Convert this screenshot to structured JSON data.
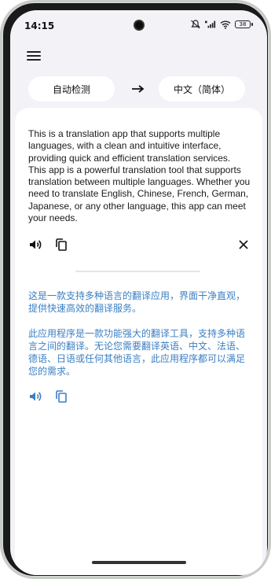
{
  "status_bar": {
    "time": "14:15",
    "battery": "38",
    "icons": [
      "mute-icon",
      "hd-signal-icon",
      "wifi-icon",
      "battery-icon"
    ]
  },
  "header": {
    "menu_icon": "menu-icon",
    "source_language": "自动检测",
    "target_language": "中文（简体）",
    "swap_icon": "arrow-right-icon"
  },
  "source": {
    "text": "This is a translation app that supports multiple languages, with a clean and intuitive interface, providing quick and efficient translation services. This app is a powerful translation tool that supports translation between multiple languages. Whether you need to translate English, Chinese, French, German, Japanese, or any other language, this app can meet your needs.",
    "actions": [
      "speaker-icon",
      "copy-icon",
      "close-icon"
    ]
  },
  "result": {
    "paragraphs": [
      "这是一款支持多种语言的翻译应用，界面干净直观，提供快速高效的翻译服务。",
      "此应用程序是一款功能强大的翻译工具，支持多种语言之间的翻译。无论您需要翻译英语、中文、法语、德语、日语或任何其他语言，此应用程序都可以满足您的需求。"
    ],
    "actions": [
      "speaker-icon",
      "copy-icon"
    ]
  },
  "colors": {
    "accent": "#3b7fc3",
    "background": "#f3f2f7",
    "card": "#ffffff"
  }
}
